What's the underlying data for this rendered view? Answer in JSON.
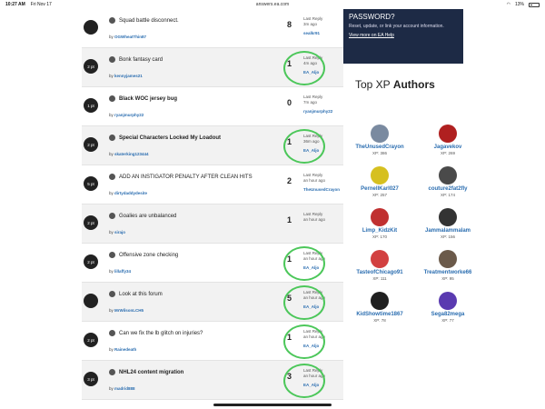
{
  "status": {
    "time": "10:27 AM",
    "date": "Fri Nov 17",
    "url": "answers.ea.com",
    "battery": "13%"
  },
  "promo": {
    "heading": "PASSWORD?",
    "sub": "Reset, update, or link your account information.",
    "link": "View more on EA Help"
  },
  "authors_title_light": "Top XP ",
  "authors_title_bold": "Authors",
  "authors": [
    {
      "name": "TheUnusedCrayon",
      "xp": "XP: 386",
      "color": "#7a8aa0"
    },
    {
      "name": "Jagavekov",
      "xp": "XP: 269",
      "color": "#b02020"
    },
    {
      "name": "PernellKarl027",
      "xp": "XP: 257",
      "color": "#d6c020"
    },
    {
      "name": "couture2fat2fly",
      "xp": "XP: 174",
      "color": "#4a4a4a"
    },
    {
      "name": "Limp_KidzKit",
      "xp": "XP: 170",
      "color": "#c03030"
    },
    {
      "name": "Jammalammalam",
      "xp": "XP: 156",
      "color": "#333333"
    },
    {
      "name": "TasteofChicago91",
      "xp": "XP: 111",
      "color": "#d24040"
    },
    {
      "name": "Treatmentworke66",
      "xp": "XP: 95",
      "color": "#6b5a4a"
    },
    {
      "name": "KidShowtime1867",
      "xp": "XP: 78",
      "color": "#202020"
    },
    {
      "name": "Sega82mega",
      "xp": "XP: 77",
      "color": "#5a3ab0"
    }
  ],
  "threads": [
    {
      "pts": "",
      "title": "Squad battle disconnect.",
      "bold": false,
      "by": "OGWheatThin87",
      "count": "8",
      "last": "Last Reply",
      "ago": "3m ago",
      "ru": "sealkr91",
      "circled": false
    },
    {
      "pts": "2 pt",
      "title": "Bonk fantasy card",
      "bold": false,
      "by": "kennyjames21",
      "count": "1",
      "last": "Last Reply",
      "ago": "4m ago",
      "ru": "EA_Aljo",
      "circled": true
    },
    {
      "pts": "1 pt",
      "title": "Black WOC jersey bug",
      "bold": true,
      "by": "ryanjmurphy22",
      "count": "0",
      "last": "Last Reply",
      "ago": "7m ago",
      "ru": "ryanjmurphy22",
      "circled": false
    },
    {
      "pts": "2 pt",
      "title": "Special Characters Locked My Loadout",
      "bold": true,
      "by": "skaterking123444",
      "count": "1",
      "last": "Last Reply",
      "ago": "36m ago",
      "ru": "EA_Aljo",
      "circled": true
    },
    {
      "pts": "5 pt",
      "title": "ADD AN INSTIGATOR PENALTY AFTER CLEAN HITS",
      "bold": false,
      "by": "dirtydaddydesite",
      "count": "2",
      "last": "Last Reply",
      "ago": "an hour ago",
      "ru": "TheUnusedCrayon",
      "circled": false
    },
    {
      "pts": "2 pt",
      "title": "Goalies are unbalanced",
      "bold": false,
      "by": "sirajo",
      "count": "1",
      "last": "Last Reply",
      "ago": "an hour ago",
      "ru": "",
      "circled": false
    },
    {
      "pts": "2 pt",
      "title": "Offensive zone checking",
      "bold": false,
      "by": "lillaffy34",
      "count": "1",
      "last": "Last Reply",
      "ago": "an hour ago",
      "ru": "EA_Aljo",
      "circled": true
    },
    {
      "pts": "",
      "title": "Look at this forum",
      "bold": false,
      "by": "MrWilsonLCH5",
      "count": "5",
      "last": "Last Reply",
      "ago": "an hour ago",
      "ru": "EA_Aljo",
      "circled": true
    },
    {
      "pts": "2 pt",
      "title": "Can we fix the lb glitch on injuries?",
      "bold": false,
      "by": "Rainedeath",
      "count": "1",
      "last": "Last Reply",
      "ago": "an hour ago",
      "ru": "EA_Aljo",
      "circled": true
    },
    {
      "pts": "3 pt",
      "title": "NHL24 content migration",
      "bold": true,
      "by": "madrid888",
      "count": "3",
      "last": "Last Reply",
      "ago": "an hour ago",
      "ru": "EA_Aljo",
      "circled": true
    }
  ],
  "by_prefix": "by "
}
